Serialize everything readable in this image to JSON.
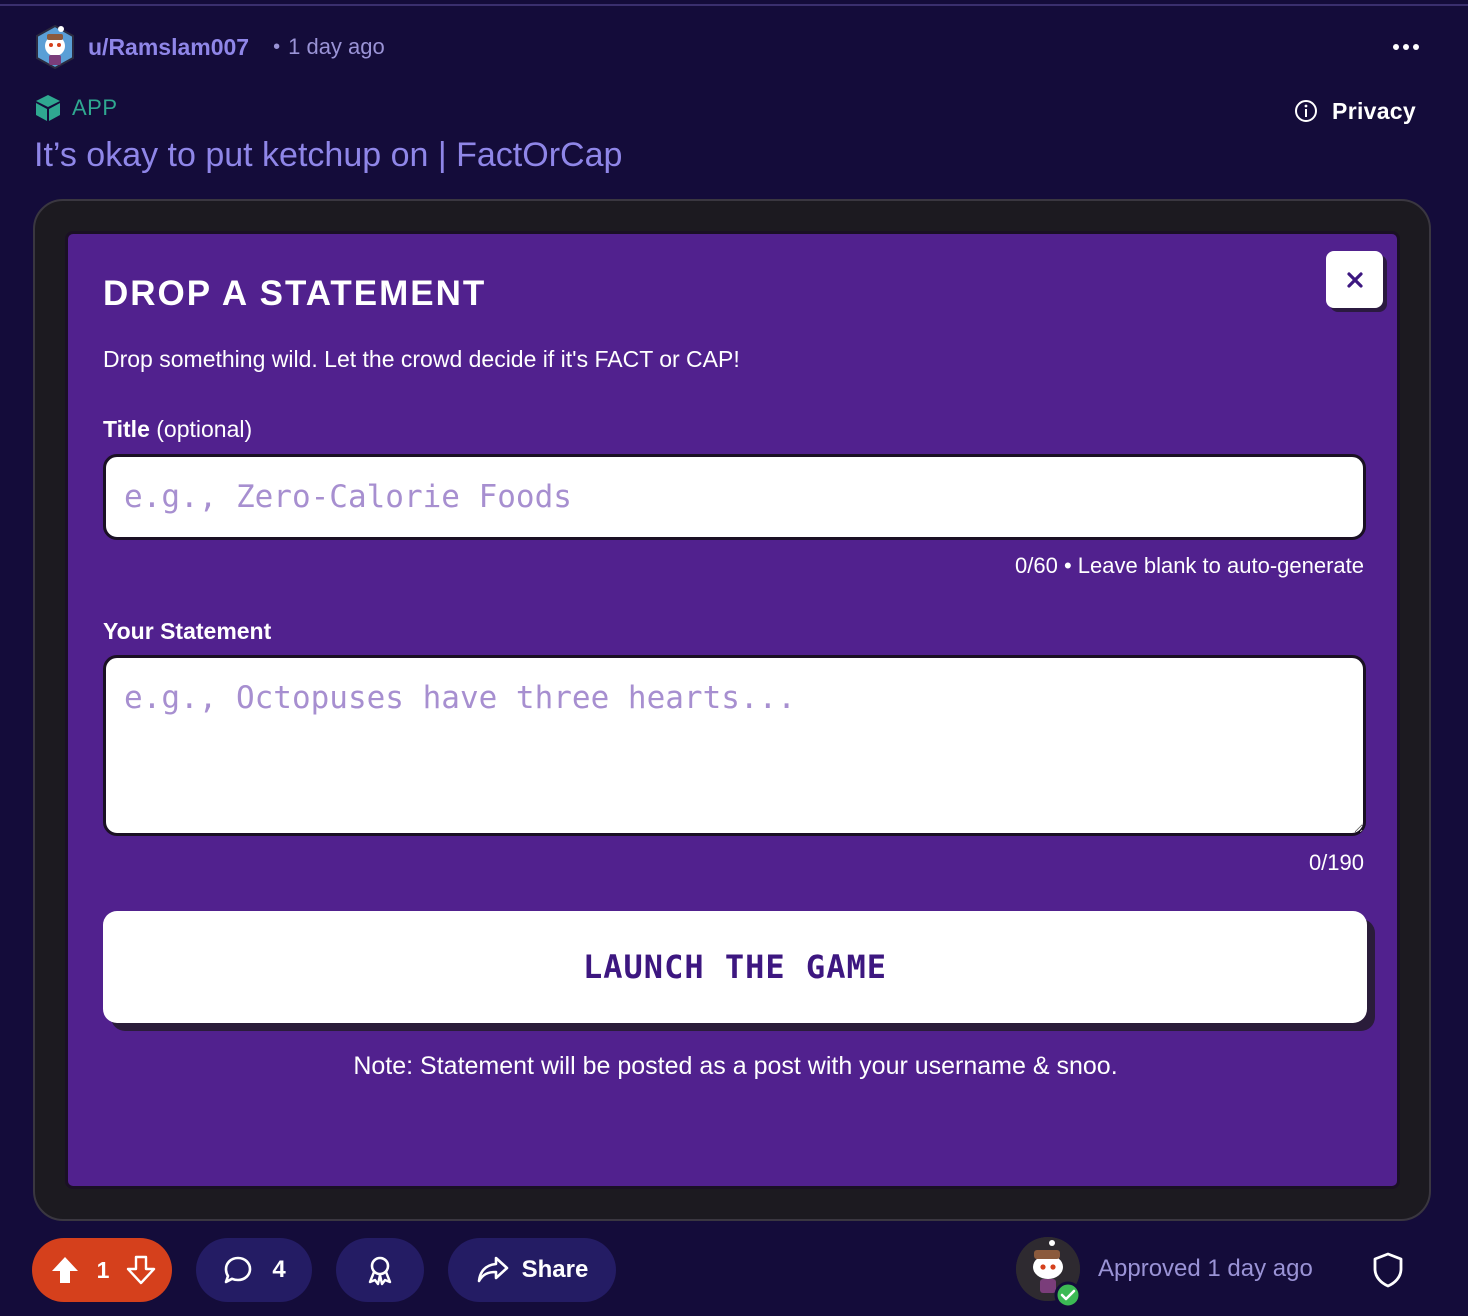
{
  "post": {
    "username": "u/Ramslam007",
    "separator": "•",
    "time_ago": "1 day ago",
    "app_label": "APP",
    "privacy_label": "Privacy",
    "title": "It’s okay to put ketchup on | FactOrCap"
  },
  "modal": {
    "heading": "DROP A STATEMENT",
    "description": "Drop something wild. Let the crowd decide if it's FACT or CAP!",
    "title_field": {
      "label_bold": "Title",
      "label_suffix": " (optional)",
      "placeholder": "e.g., Zero-Calorie Foods",
      "value": "",
      "helper": "0/60 • Leave blank to auto-generate"
    },
    "statement_field": {
      "label": "Your Statement",
      "placeholder": "e.g., Octopuses have three hearts...",
      "value": "",
      "counter": "0/190"
    },
    "launch_label": "LAUNCH THE GAME",
    "note": "Note: Statement will be posted as a post with your username & snoo.",
    "close_symbol": "×"
  },
  "footer": {
    "vote_count": "1",
    "comment_count": "4",
    "share_label": "Share",
    "approved_text": "Approved 1 day ago"
  },
  "colors": {
    "page_bg": "#140c3a",
    "modal_bg": "#51218e",
    "link_purple": "#8f86e8",
    "upvote_orange": "#d5401c",
    "app_green": "#2fa890"
  },
  "icons": [
    "user-avatar-icon",
    "more-options-icon",
    "app-cube-icon",
    "info-icon",
    "close-icon",
    "upvote-icon",
    "downvote-icon",
    "comment-icon",
    "award-icon",
    "share-icon",
    "approved-check-icon",
    "mod-shield-icon"
  ]
}
